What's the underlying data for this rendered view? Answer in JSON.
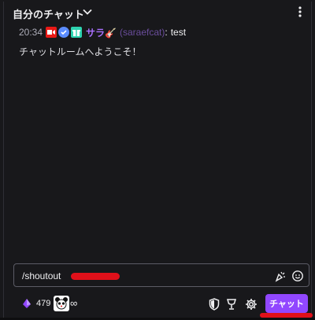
{
  "header": {
    "title": "自分のチャット"
  },
  "chat": {
    "messages": [
      {
        "timestamp": "20:34",
        "badges": [
          "live-icon",
          "verified-icon",
          "gift-icon"
        ],
        "display_name": "サラ🎸",
        "login": "(saraefcat)",
        "separator": ":",
        "text": "test"
      }
    ],
    "welcome": "チャットルームへようこそ！"
  },
  "input": {
    "value": "/shoutout"
  },
  "footer": {
    "bits_count": "479",
    "points_symbol": "∞",
    "chat_button_label": "チャット"
  },
  "colors": {
    "accent": "#9147ff",
    "username": "#a970ff",
    "background": "#18181b",
    "redaction": "#e0101a"
  }
}
